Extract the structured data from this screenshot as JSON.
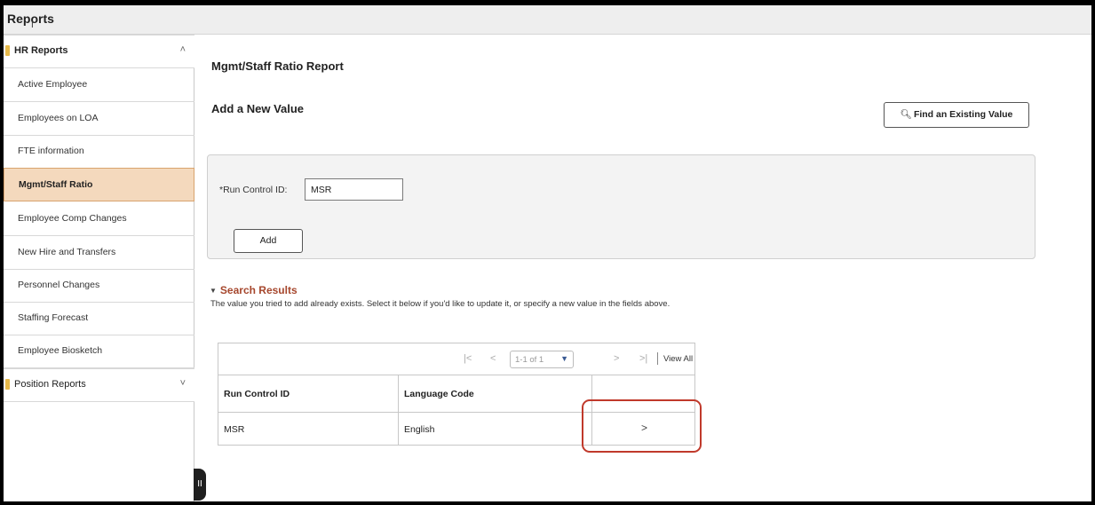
{
  "topbar": {
    "title": "Reports"
  },
  "sidebar": {
    "groups": [
      {
        "label": "HR Reports",
        "chevron": "^"
      },
      {
        "label": "Position Reports",
        "chevron": "v"
      }
    ],
    "items": [
      {
        "label": "Active Employee"
      },
      {
        "label": "Employees on LOA"
      },
      {
        "label": "FTE information"
      },
      {
        "label": "Mgmt/Staff Ratio"
      },
      {
        "label": "Employee Comp Changes"
      },
      {
        "label": "New Hire and Transfers"
      },
      {
        "label": "Personnel Changes"
      },
      {
        "label": "Staffing Forecast"
      },
      {
        "label": "Employee Biosketch"
      }
    ],
    "collapse_glyph": "II"
  },
  "main": {
    "page_title": "Mgmt/Staff Ratio Report",
    "section_title": "Add a New Value",
    "find_button": "Find an Existing Value",
    "run_control_label": "*Run Control ID:",
    "run_control_value": "MSR",
    "add_button": "Add",
    "search_results": {
      "heading": "Search Results",
      "message": "The value you tried to add already exists. Select it below if you'd like to update it, or specify a new value in the fields above.",
      "pager": {
        "first": "|<",
        "prev": "<",
        "range": "1-1 of 1",
        "next": ">",
        "last": ">|",
        "view_all": "View All"
      },
      "columns": [
        "Run Control ID",
        "Language Code"
      ],
      "rows": [
        {
          "run_control_id": "MSR",
          "language_code": "English",
          "action": ">"
        }
      ]
    }
  },
  "colors": {
    "active_item_bg": "#f4d9bd",
    "accent_heading": "#a6472d",
    "highlight": "#c0392b",
    "folder": "#e6b94a"
  }
}
